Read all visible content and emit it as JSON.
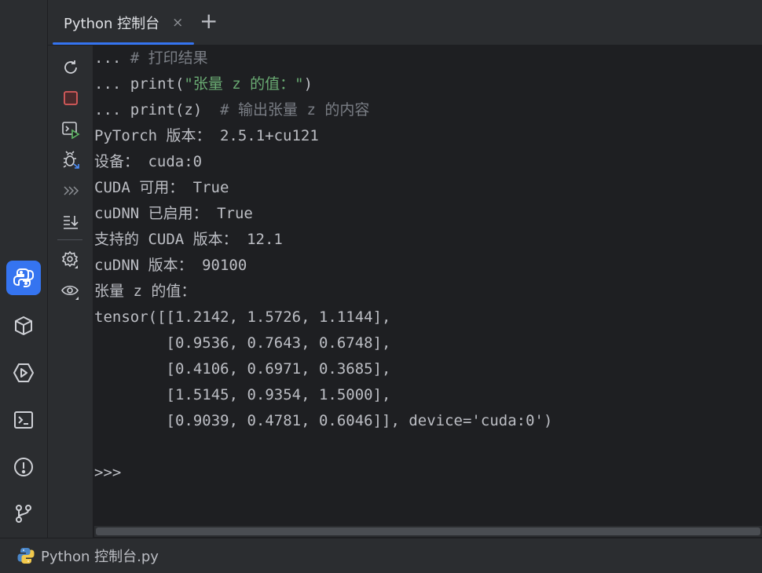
{
  "tab": {
    "label": "Python 控制台",
    "close_glyph": "×",
    "add_glyph": "+"
  },
  "left_strip": {
    "items": [
      {
        "icon": "python-console-icon",
        "active": true
      },
      {
        "icon": "python-packages-icon"
      },
      {
        "icon": "services-icon"
      },
      {
        "icon": "terminal-icon"
      },
      {
        "icon": "problems-icon"
      },
      {
        "icon": "git-icon"
      }
    ]
  },
  "toolbar": {
    "items": [
      "rerun-icon",
      "stop-icon",
      "execute-console-icon",
      "debug-icon",
      "console-history-icon",
      "scroll-to-end-icon",
      "settings-icon",
      "variables-view-icon"
    ]
  },
  "console": {
    "lines": [
      {
        "parts": [
          {
            "t": "... ",
            "c": ""
          },
          {
            "t": "# 打印结果",
            "c": "comment"
          }
        ]
      },
      {
        "parts": [
          {
            "t": "... print(",
            "c": ""
          },
          {
            "t": "\"张量 z 的值：\"",
            "c": "string"
          },
          {
            "t": ")",
            "c": ""
          }
        ]
      },
      {
        "parts": [
          {
            "t": "... print(z)  ",
            "c": ""
          },
          {
            "t": "# 输出张量 z 的内容",
            "c": "comment"
          }
        ]
      },
      {
        "parts": [
          {
            "t": "PyTorch 版本： 2.5.1+cu121",
            "c": ""
          }
        ]
      },
      {
        "parts": [
          {
            "t": "设备： cuda:0",
            "c": ""
          }
        ]
      },
      {
        "parts": [
          {
            "t": "CUDA 可用： True",
            "c": ""
          }
        ]
      },
      {
        "parts": [
          {
            "t": "cuDNN 已启用： True",
            "c": ""
          }
        ]
      },
      {
        "parts": [
          {
            "t": "支持的 CUDA 版本： 12.1",
            "c": ""
          }
        ]
      },
      {
        "parts": [
          {
            "t": "cuDNN 版本： 90100",
            "c": ""
          }
        ]
      },
      {
        "parts": [
          {
            "t": "张量 z 的值：",
            "c": ""
          }
        ]
      },
      {
        "parts": [
          {
            "t": "tensor([[1.2142, 1.5726, 1.1144],",
            "c": ""
          }
        ]
      },
      {
        "parts": [
          {
            "t": "        [0.9536, 0.7643, 0.6748],",
            "c": ""
          }
        ]
      },
      {
        "parts": [
          {
            "t": "        [0.4106, 0.6971, 0.3685],",
            "c": ""
          }
        ]
      },
      {
        "parts": [
          {
            "t": "        [1.5145, 0.9354, 1.5000],",
            "c": ""
          }
        ]
      },
      {
        "parts": [
          {
            "t": "        [0.9039, 0.4781, 0.6046]], device='cuda:0')",
            "c": ""
          }
        ]
      },
      {
        "parts": [
          {
            "t": "",
            "c": ""
          }
        ]
      },
      {
        "parts": [
          {
            "t": ">>>",
            "c": ""
          }
        ]
      }
    ]
  },
  "status": {
    "file_label": "Python 控制台.py"
  },
  "colors": {
    "accent": "#3574f0",
    "string": "#6aab73",
    "comment": "#7a7e85",
    "stop": "#db5c5c"
  }
}
